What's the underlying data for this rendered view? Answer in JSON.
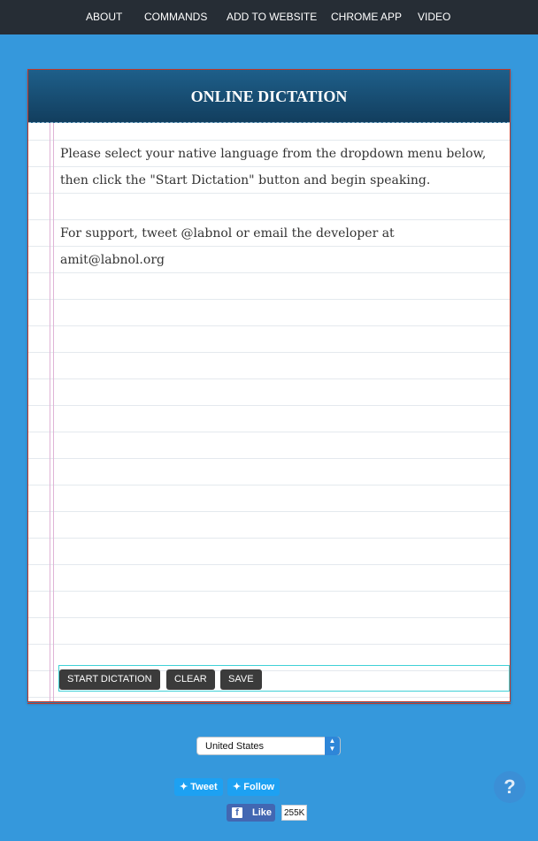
{
  "nav": {
    "items": [
      {
        "label": "ABOUT"
      },
      {
        "label": "COMMANDS"
      },
      {
        "label": "ADD TO WEBSITE"
      },
      {
        "label": "CHROME APP"
      },
      {
        "label": "VIDEO"
      }
    ]
  },
  "editor": {
    "title": "ONLINE DICTATION",
    "paragraph1": "Please select your native language from the dropdown menu below, then click the \"Start Dictation\" button and begin speaking.",
    "paragraph2": "For support, tweet @labnol or email the developer at amit@labnol.org"
  },
  "buttons": {
    "start": "START DICTATION",
    "clear": "CLEAR",
    "save": "SAVE"
  },
  "language": {
    "selected": "United States"
  },
  "social": {
    "tweet": "Tweet",
    "follow": "Follow",
    "like": "Like",
    "like_count": "255K"
  },
  "help": {
    "symbol": "?"
  },
  "colors": {
    "background": "#3598dc",
    "nav": "#262d35",
    "header": "#1a5580",
    "button": "#3b3b3b",
    "twitter": "#1da1f2",
    "facebook": "#4267b2"
  }
}
